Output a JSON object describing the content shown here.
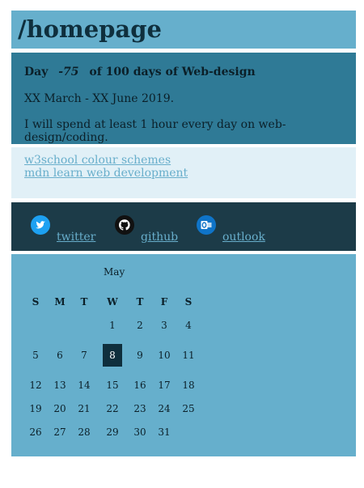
{
  "header": {
    "title": "/homepage"
  },
  "intro": {
    "day_label": "Day",
    "day_number": "-75",
    "day_suffix": "of 100 days of Web-design",
    "dates": "XX March - XX June 2019.",
    "commitment": "I will spend at least 1 hour every day on web-design/coding."
  },
  "links": [
    {
      "label": "w3school colour schemes"
    },
    {
      "label": "mdn learn web development"
    }
  ],
  "social": [
    {
      "label": "twitter",
      "icon": "twitter-icon",
      "color": "#1da1f2"
    },
    {
      "label": "github",
      "icon": "github-icon",
      "color": "#111111"
    },
    {
      "label": "outlook",
      "icon": "outlook-icon",
      "color": "#0f74c8"
    }
  ],
  "calendar": {
    "month": "May",
    "weekdays": [
      "S",
      "M",
      "T",
      "W",
      "T",
      "F",
      "S"
    ],
    "weeks": [
      [
        "",
        "",
        "",
        "1",
        "2",
        "3",
        "4"
      ],
      [
        "5",
        "6",
        "7",
        "8",
        "9",
        "10",
        "11"
      ],
      [
        "12",
        "13",
        "14",
        "15",
        "16",
        "17",
        "18"
      ],
      [
        "19",
        "20",
        "21",
        "22",
        "23",
        "24",
        "25"
      ],
      [
        "26",
        "27",
        "28",
        "29",
        "30",
        "31",
        ""
      ]
    ],
    "today": "8"
  }
}
